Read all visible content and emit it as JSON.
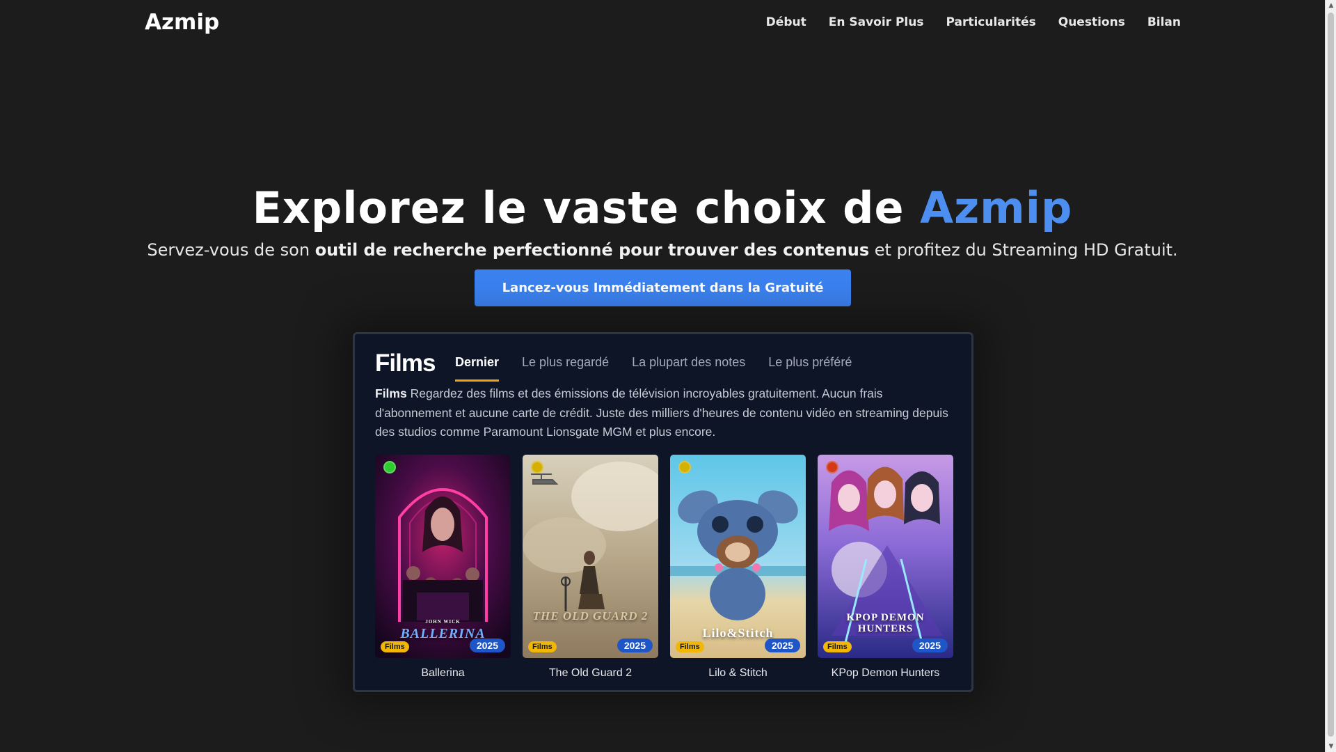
{
  "nav": {
    "logo": "Azmip",
    "links": [
      "Début",
      "En Savoir Plus",
      "Particularités",
      "Questions",
      "Bilan"
    ]
  },
  "hero": {
    "title_prefix": "Explorez le vaste choix de",
    "title_accent": "Azmip",
    "subtitle_start": "Servez-vous de son",
    "subtitle_bold": "outil de recherche perfectionné pour trouver des contenus",
    "subtitle_end": "et profitez du Streaming HD Gratuit.",
    "cta_label": "Lancez-vous Immédiatement dans la Gratuité"
  },
  "preview": {
    "heading": "Films",
    "tabs": [
      "Dernier",
      "Le plus regardé",
      "La plupart des notes",
      "Le plus préféré"
    ],
    "active_tab": "Dernier",
    "desc_bold": "Films",
    "desc_text": "Regardez des films et des émissions de télévision incroyables gratuitement. Aucun frais d'abonnement et aucune carte de crédit. Juste des milliers d'heures de contenu vidéo en streaming depuis des studios comme Paramount Lionsgate MGM et plus encore.",
    "cards": [
      {
        "title": "Ballerina",
        "type": "Films",
        "year": "2025",
        "status_color": "#2ecc2e",
        "poster_text": "BALLERINA",
        "poster_top": "JOHN WICK"
      },
      {
        "title": "The Old Guard 2",
        "type": "Films",
        "year": "2025",
        "status_color": "#d4b000",
        "poster_text": "THE OLD GUARD 2",
        "poster_top": ""
      },
      {
        "title": "Lilo & Stitch",
        "type": "Films",
        "year": "2025",
        "status_color": "#d4b000",
        "poster_text": "Lilo&Stitch",
        "poster_top": ""
      },
      {
        "title": "KPop Demon Hunters",
        "type": "Films",
        "year": "2025",
        "status_color": "#d23a1a",
        "poster_text": "KPOP DEMON HUNTERS",
        "poster_top": ""
      }
    ]
  },
  "colors": {
    "background": "#1c1c1c",
    "accent": "#4d8ff0",
    "cta": "#3b82f0",
    "tab_underline": "#f0a418",
    "type_badge": "#f2b705",
    "year_badge": "#1e56c8"
  }
}
